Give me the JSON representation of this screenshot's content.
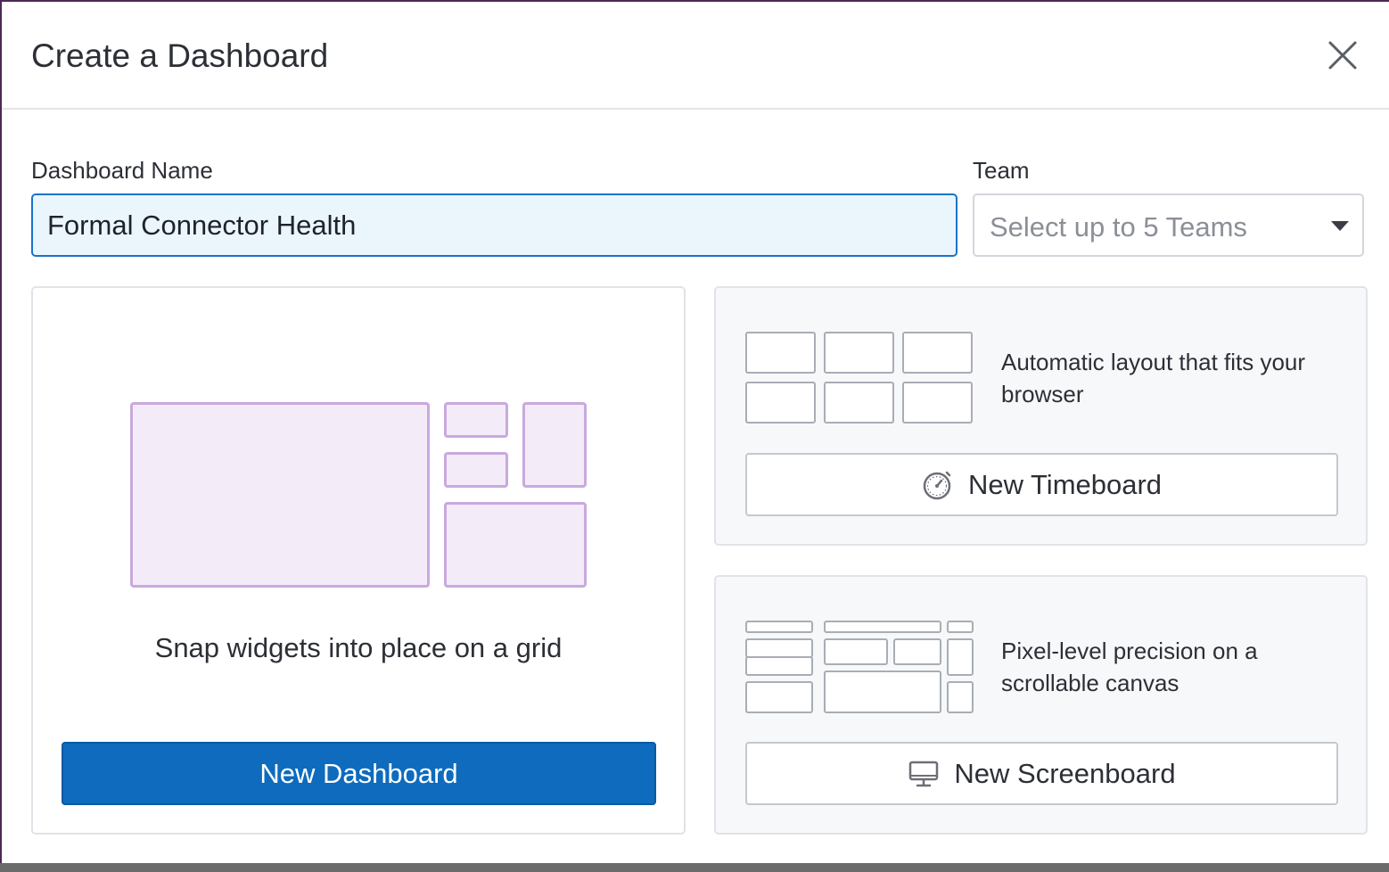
{
  "dialog": {
    "title": "Create a Dashboard",
    "close_icon": "close-icon"
  },
  "form": {
    "name_label": "Dashboard Name",
    "name_value": "Formal Connector Health",
    "team_label": "Team",
    "team_placeholder": "Select up to 5 Teams",
    "team_arrow_icon": "caret-down-icon"
  },
  "dashboard_card": {
    "description": "Snap widgets into place on a grid",
    "button_label": "New Dashboard",
    "illustration": "grid-layout-illustration"
  },
  "timeboard_card": {
    "description": "Automatic layout that fits your browser",
    "button_label": "New Timeboard",
    "button_icon": "stopwatch-icon",
    "illustration": "auto-layout-illustration"
  },
  "screenboard_card": {
    "description": "Pixel-level precision on a scrollable canvas",
    "button_label": "New Screenboard",
    "button_icon": "monitor-icon",
    "illustration": "free-layout-illustration"
  },
  "colors": {
    "primary": "#0e6bbd",
    "input_focus_bg": "#eaf6fc",
    "illustration_purple": "#c9a9df",
    "backdrop": "#4a2a52"
  }
}
